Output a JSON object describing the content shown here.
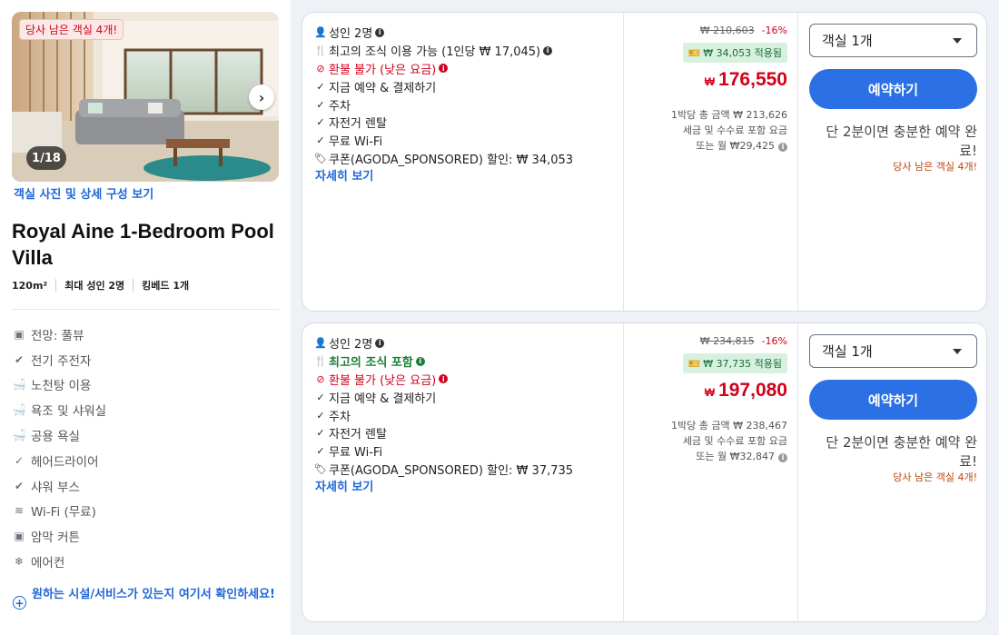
{
  "room": {
    "availability_badge": "당사 남은 객실 4개!",
    "photo_counter": "1/18",
    "view_photos_link": "객실 사진 및 상세 구성 보기",
    "title": "Royal Aine 1-Bedroom Pool Villa",
    "specs": [
      "120m²",
      "최대 성인 2명",
      "킹베드 1개"
    ],
    "amenities": [
      {
        "icon": "view-icon",
        "label": "전망: 풀뷰"
      },
      {
        "icon": "check-circle-icon",
        "label": "전기 주전자"
      },
      {
        "icon": "bathtub-icon",
        "label": "노천탕 이용"
      },
      {
        "icon": "bathtub-icon",
        "label": "욕조 및 샤워실"
      },
      {
        "icon": "bathtub-icon",
        "label": "공용 욕실"
      },
      {
        "icon": "check-icon",
        "label": "헤어드라이어"
      },
      {
        "icon": "check-circle-icon",
        "label": "샤워 부스"
      },
      {
        "icon": "wifi-icon",
        "label": "Wi-Fi (무료)"
      },
      {
        "icon": "blackout-icon",
        "label": "암막 커튼"
      },
      {
        "icon": "snowflake-icon",
        "label": "에어컨"
      }
    ],
    "facility_link": "원하는 시설/서비스가 있는지 여기서 확인하세요!"
  },
  "offers": [
    {
      "benefits": [
        {
          "icon": "person-icon",
          "text": "성인 2명",
          "info": true,
          "style": "normal"
        },
        {
          "icon": "cutlery-icon",
          "text": "최고의 조식 이용 가능 (1인당 ₩ 17,045)",
          "info": true,
          "style": "normal"
        },
        {
          "icon": "no-icon",
          "text": "환불 불가 (낮은 요금)",
          "info": true,
          "style": "red"
        },
        {
          "icon": "check-icon",
          "text": "지금 예약 & 결제하기",
          "info": false,
          "style": "normal"
        },
        {
          "icon": "check-icon",
          "text": "주차",
          "info": false,
          "style": "normal"
        },
        {
          "icon": "check-icon",
          "text": "자전거 렌탈",
          "info": false,
          "style": "normal"
        },
        {
          "icon": "check-icon",
          "text": "무료 Wi-Fi",
          "info": false,
          "style": "normal"
        },
        {
          "icon": "tag-icon",
          "text": "쿠폰(AGODA_SPONSORED) 할인: ₩ 34,053",
          "info": false,
          "style": "normal"
        }
      ],
      "details_link": "자세히 보기",
      "original_price": "₩ 210,603",
      "discount_pct": "-16%",
      "coupon_applied": "₩ 34,053 적용됨",
      "currency": "₩",
      "price": "176,550",
      "note_line1": "1박당 총 금액 ₩ 213,626",
      "note_line2": "세금 및 수수료 포함 요금",
      "note_line3": "또는 월 ₩29,425",
      "room_select": "객실 1개",
      "book_button": "예약하기",
      "quick_note": "단 2분이면 충분한 예약 완료!",
      "rooms_left": "당사 남은 객실 4개!"
    },
    {
      "benefits": [
        {
          "icon": "person-icon",
          "text": "성인 2명",
          "info": true,
          "style": "normal"
        },
        {
          "icon": "cutlery-icon",
          "text": "최고의 조식 포함",
          "info": true,
          "style": "green"
        },
        {
          "icon": "no-icon",
          "text": "환불 불가 (낮은 요금)",
          "info": true,
          "style": "red"
        },
        {
          "icon": "check-icon",
          "text": "지금 예약 & 결제하기",
          "info": false,
          "style": "normal"
        },
        {
          "icon": "check-icon",
          "text": "주차",
          "info": false,
          "style": "normal"
        },
        {
          "icon": "check-icon",
          "text": "자전거 렌탈",
          "info": false,
          "style": "normal"
        },
        {
          "icon": "check-icon",
          "text": "무료 Wi-Fi",
          "info": false,
          "style": "normal"
        },
        {
          "icon": "tag-icon",
          "text": "쿠폰(AGODA_SPONSORED) 할인: ₩ 37,735",
          "info": false,
          "style": "normal"
        }
      ],
      "details_link": "자세히 보기",
      "original_price": "₩ 234,815",
      "discount_pct": "-16%",
      "coupon_applied": "₩ 37,735 적용됨",
      "currency": "₩",
      "price": "197,080",
      "note_line1": "1박당 총 금액 ₩ 238,467",
      "note_line2": "세금 및 수수료 포함 요금",
      "note_line3": "또는 월 ₩32,847",
      "room_select": "객실 1개",
      "book_button": "예약하기",
      "quick_note": "단 2분이면 충분한 예약 완료!",
      "rooms_left": "당사 남은 객실 4개!"
    }
  ],
  "colors": {
    "accent_blue": "#2b70e4",
    "price_red": "#d0021b",
    "green": "#1a7f37",
    "page_bg": "#eef2f7"
  }
}
